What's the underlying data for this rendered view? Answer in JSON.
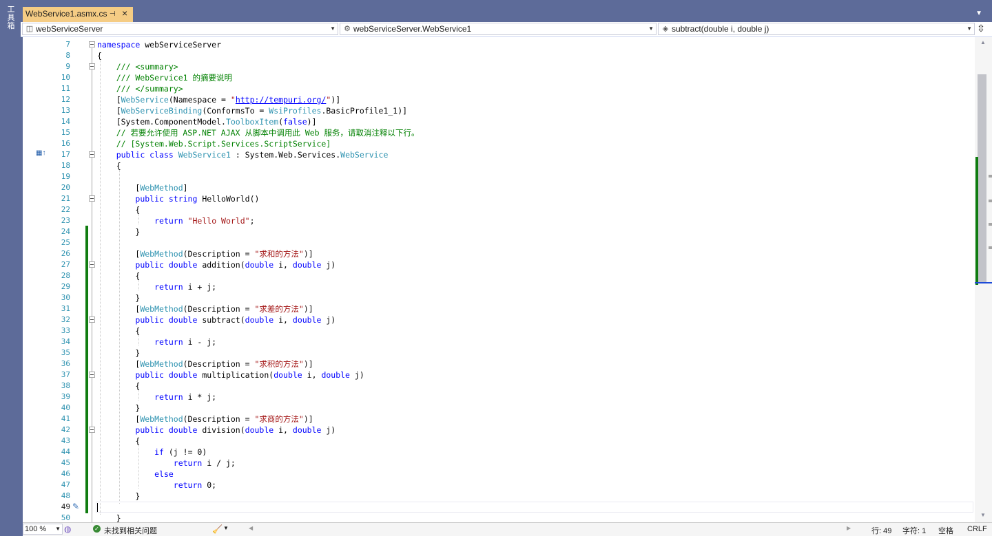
{
  "toolbox": {
    "label": "工具箱"
  },
  "tab": {
    "title": "WebService1.asmx.cs",
    "pin_icon": "pin-icon",
    "close_icon": "close-icon"
  },
  "nav": {
    "project": "webServiceServer",
    "class": "webServiceServer.WebService1",
    "member": "subtract(double i, double j)"
  },
  "editor": {
    "current_line": 49,
    "lines": [
      {
        "n": 7
      },
      {
        "n": 8
      },
      {
        "n": 9
      },
      {
        "n": 10
      },
      {
        "n": 11
      },
      {
        "n": 12
      },
      {
        "n": 13
      },
      {
        "n": 14
      },
      {
        "n": 15
      },
      {
        "n": 16
      },
      {
        "n": 17
      },
      {
        "n": 18
      },
      {
        "n": 19
      },
      {
        "n": 20
      },
      {
        "n": 21
      },
      {
        "n": 22
      },
      {
        "n": 23
      },
      {
        "n": 24
      },
      {
        "n": 25
      },
      {
        "n": 26
      },
      {
        "n": 27
      },
      {
        "n": 28
      },
      {
        "n": 29
      },
      {
        "n": 30
      },
      {
        "n": 31
      },
      {
        "n": 32
      },
      {
        "n": 33
      },
      {
        "n": 34
      },
      {
        "n": 35
      },
      {
        "n": 36
      },
      {
        "n": 37
      },
      {
        "n": 38
      },
      {
        "n": 39
      },
      {
        "n": 40
      },
      {
        "n": 41
      },
      {
        "n": 42
      },
      {
        "n": 43
      },
      {
        "n": 44
      },
      {
        "n": 45
      },
      {
        "n": 46
      },
      {
        "n": 47
      },
      {
        "n": 48
      },
      {
        "n": 49
      },
      {
        "n": 50
      }
    ],
    "code": {
      "l7": [
        {
          "t": "namespace",
          "c": "kw"
        },
        {
          "t": " webServiceServer"
        }
      ],
      "l8": [
        {
          "t": "{"
        }
      ],
      "l9": [
        {
          "t": "    /// <summary>",
          "c": "cm"
        }
      ],
      "l10": [
        {
          "t": "    /// WebService1 的摘要说明",
          "c": "cm"
        }
      ],
      "l11": [
        {
          "t": "    /// </summary>",
          "c": "cm"
        }
      ],
      "l12": [
        {
          "t": "    ["
        },
        {
          "t": "WebService",
          "c": "ty"
        },
        {
          "t": "(Namespace = "
        },
        {
          "t": "\"",
          "c": "st"
        },
        {
          "t": "http://tempuri.org/",
          "c": "url"
        },
        {
          "t": "\"",
          "c": "st"
        },
        {
          "t": ")]"
        }
      ],
      "l13": [
        {
          "t": "    ["
        },
        {
          "t": "WebServiceBinding",
          "c": "ty"
        },
        {
          "t": "(ConformsTo = "
        },
        {
          "t": "WsiProfiles",
          "c": "ty"
        },
        {
          "t": ".BasicProfile1_1)]"
        }
      ],
      "l14": [
        {
          "t": "    [System.ComponentModel."
        },
        {
          "t": "ToolboxItem",
          "c": "ty"
        },
        {
          "t": "("
        },
        {
          "t": "false",
          "c": "kw"
        },
        {
          "t": ")]"
        }
      ],
      "l15": [
        {
          "t": "    // 若要允许使用 ASP.NET AJAX 从脚本中调用此 Web 服务，请取消注释以下行。",
          "c": "cm"
        }
      ],
      "l16": [
        {
          "t": "    // [System.Web.Script.Services.ScriptService]",
          "c": "cm"
        }
      ],
      "l17": [
        {
          "t": "    "
        },
        {
          "t": "public class",
          "c": "kw"
        },
        {
          "t": " "
        },
        {
          "t": "WebService1",
          "c": "ty"
        },
        {
          "t": " : System.Web.Services."
        },
        {
          "t": "WebService",
          "c": "ty"
        }
      ],
      "l18": [
        {
          "t": "    {"
        }
      ],
      "l19": [
        {
          "t": ""
        }
      ],
      "l20": [
        {
          "t": "        ["
        },
        {
          "t": "WebMethod",
          "c": "ty"
        },
        {
          "t": "]"
        }
      ],
      "l21": [
        {
          "t": "        "
        },
        {
          "t": "public string",
          "c": "kw"
        },
        {
          "t": " HelloWorld()"
        }
      ],
      "l22": [
        {
          "t": "        {"
        }
      ],
      "l23": [
        {
          "t": "            "
        },
        {
          "t": "return",
          "c": "kw"
        },
        {
          "t": " "
        },
        {
          "t": "\"Hello World\"",
          "c": "st"
        },
        {
          "t": ";"
        }
      ],
      "l24": [
        {
          "t": "        }"
        }
      ],
      "l25": [
        {
          "t": ""
        }
      ],
      "l26": [
        {
          "t": "        ["
        },
        {
          "t": "WebMethod",
          "c": "ty"
        },
        {
          "t": "(Description = "
        },
        {
          "t": "\"求和的方法\"",
          "c": "st"
        },
        {
          "t": ")]"
        }
      ],
      "l27": [
        {
          "t": "        "
        },
        {
          "t": "public double",
          "c": "kw"
        },
        {
          "t": " addition("
        },
        {
          "t": "double",
          "c": "kw"
        },
        {
          "t": " i, "
        },
        {
          "t": "double",
          "c": "kw"
        },
        {
          "t": " j)"
        }
      ],
      "l28": [
        {
          "t": "        {"
        }
      ],
      "l29": [
        {
          "t": "            "
        },
        {
          "t": "return",
          "c": "kw"
        },
        {
          "t": " i + j;"
        }
      ],
      "l30": [
        {
          "t": "        }"
        }
      ],
      "l31": [
        {
          "t": "        ["
        },
        {
          "t": "WebMethod",
          "c": "ty"
        },
        {
          "t": "(Description = "
        },
        {
          "t": "\"求差的方法\"",
          "c": "st"
        },
        {
          "t": ")]"
        }
      ],
      "l32": [
        {
          "t": "        "
        },
        {
          "t": "public double",
          "c": "kw"
        },
        {
          "t": " subtract("
        },
        {
          "t": "double",
          "c": "kw"
        },
        {
          "t": " i, "
        },
        {
          "t": "double",
          "c": "kw"
        },
        {
          "t": " j)"
        }
      ],
      "l33": [
        {
          "t": "        {"
        }
      ],
      "l34": [
        {
          "t": "            "
        },
        {
          "t": "return",
          "c": "kw"
        },
        {
          "t": " i - j;"
        }
      ],
      "l35": [
        {
          "t": "        }"
        }
      ],
      "l36": [
        {
          "t": "        ["
        },
        {
          "t": "WebMethod",
          "c": "ty"
        },
        {
          "t": "(Description = "
        },
        {
          "t": "\"求积的方法\"",
          "c": "st"
        },
        {
          "t": ")]"
        }
      ],
      "l37": [
        {
          "t": "        "
        },
        {
          "t": "public double",
          "c": "kw"
        },
        {
          "t": " multiplication("
        },
        {
          "t": "double",
          "c": "kw"
        },
        {
          "t": " i, "
        },
        {
          "t": "double",
          "c": "kw"
        },
        {
          "t": " j)"
        }
      ],
      "l38": [
        {
          "t": "        {"
        }
      ],
      "l39": [
        {
          "t": "            "
        },
        {
          "t": "return",
          "c": "kw"
        },
        {
          "t": " i * j;"
        }
      ],
      "l40": [
        {
          "t": "        }"
        }
      ],
      "l41": [
        {
          "t": "        ["
        },
        {
          "t": "WebMethod",
          "c": "ty"
        },
        {
          "t": "(Description = "
        },
        {
          "t": "\"求商的方法\"",
          "c": "st"
        },
        {
          "t": ")]"
        }
      ],
      "l42": [
        {
          "t": "        "
        },
        {
          "t": "public double",
          "c": "kw"
        },
        {
          "t": " division("
        },
        {
          "t": "double",
          "c": "kw"
        },
        {
          "t": " i, "
        },
        {
          "t": "double",
          "c": "kw"
        },
        {
          "t": " j)"
        }
      ],
      "l43": [
        {
          "t": "        {"
        }
      ],
      "l44": [
        {
          "t": "            "
        },
        {
          "t": "if",
          "c": "kw"
        },
        {
          "t": " (j != 0)"
        }
      ],
      "l45": [
        {
          "t": "                "
        },
        {
          "t": "return",
          "c": "kw"
        },
        {
          "t": " i / j;"
        }
      ],
      "l46": [
        {
          "t": "            "
        },
        {
          "t": "else",
          "c": "kw"
        }
      ],
      "l47": [
        {
          "t": "                "
        },
        {
          "t": "return",
          "c": "kw"
        },
        {
          "t": " 0;"
        }
      ],
      "l48": [
        {
          "t": "        }"
        }
      ],
      "l49": [
        {
          "t": ""
        }
      ],
      "l50": [
        {
          "t": "    }"
        }
      ]
    }
  },
  "status": {
    "zoom": "100 %",
    "issues": "未找到相关问题",
    "line": "行: 49",
    "col": "字符: 1",
    "whitespace": "空格",
    "eol": "CRLF"
  },
  "colors": {
    "keyword": "#0000ff",
    "type": "#2b91af",
    "comment": "#008000",
    "string": "#a31515",
    "change_bar": "#107c10",
    "chrome": "#5d6b99",
    "tab_active": "#f5cc84"
  }
}
